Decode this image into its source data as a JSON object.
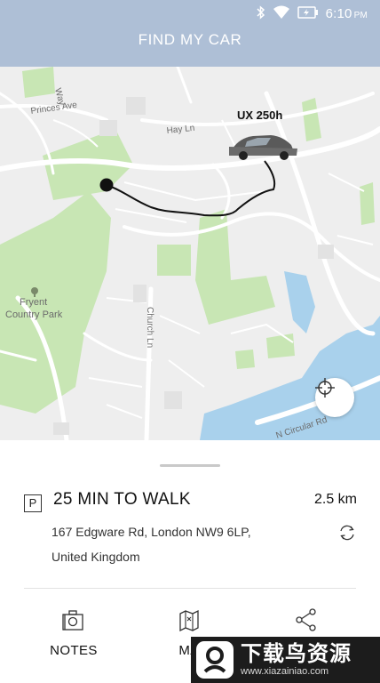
{
  "status_bar": {
    "time": "6:10",
    "ampm": "PM",
    "icons": [
      "bluetooth-icon",
      "wifi-icon",
      "battery-charging-icon"
    ]
  },
  "header": {
    "title": "FIND MY CAR"
  },
  "map": {
    "labels": {
      "princes_ave": "Princes Ave",
      "hay_ln": "Hay Ln",
      "way": "Way",
      "fryent_1": "Fryent",
      "fryent_2": "Country Park",
      "church_ln": "Church Ln",
      "circular_rd": "N Circular Rd"
    },
    "car_label": "UX 250h",
    "colors": {
      "park": "#c8e6b4",
      "water": "#a9d1ec",
      "road": "#ffffff",
      "route": "#111111"
    }
  },
  "details": {
    "parking_badge": "P",
    "walk_time": "25 MIN TO WALK",
    "distance": "2.5 km",
    "address_line1": "167 Edgware Rd, London NW9 6LP,",
    "address_line2": "United Kingdom"
  },
  "tabs": [
    {
      "label": "NOTES",
      "icon": "notes-camera-icon"
    },
    {
      "label": "MA",
      "icon": "map-icon"
    },
    {
      "label": "",
      "icon": "share-icon"
    }
  ],
  "watermark": {
    "text": "下载鸟资源",
    "url": "www.xiazainiao.com"
  }
}
